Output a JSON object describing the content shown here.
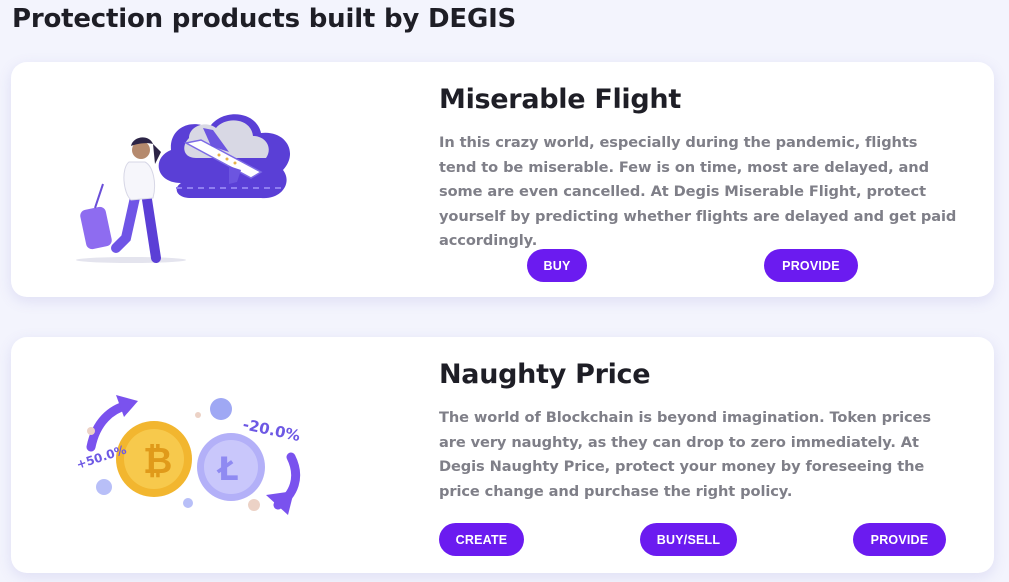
{
  "page": {
    "title": "Protection products built by DEGIS"
  },
  "products": [
    {
      "title": "Miserable Flight",
      "description": "In this crazy world, especially during the pandemic, flights tend to be miserable. Few is on time, most are delayed, and some are even cancelled. At Degis Miserable Flight, protect yourself by predicting whether flights are delayed and get paid accordingly.",
      "buttons": [
        "BUY",
        "PROVIDE"
      ],
      "illustration": "traveler-with-airplane-illustration"
    },
    {
      "title": "Naughty Price",
      "description": "The world of Blockchain is beyond imagination. Token prices are very naughty, as they can drop to zero immediately. At Degis Naughty Price, protect your money by foreseeing the price change and purchase the right policy.",
      "buttons": [
        "CREATE",
        "BUY/SELL",
        "PROVIDE"
      ],
      "illustration": "crypto-coins-illustration",
      "illustration_labels": [
        "+50.0%",
        "-20.0%"
      ]
    }
  ],
  "colors": {
    "accent": "#6b1bf0",
    "background": "#f3f4fd",
    "card": "#ffffff",
    "text": "#1e1e26",
    "muted_text": "#7f7f88"
  }
}
